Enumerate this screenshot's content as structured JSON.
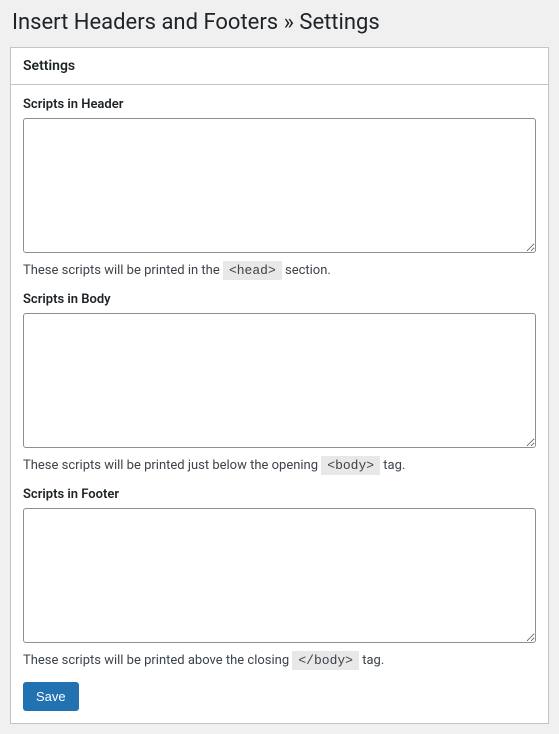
{
  "page_title": "Insert Headers and Footers » Settings",
  "panel": {
    "header_title": "Settings"
  },
  "fields": {
    "header": {
      "label": "Scripts in Header",
      "value": "",
      "help_text_prefix": "These scripts will be printed in the ",
      "help_code": "<head>",
      "help_text_suffix": " section."
    },
    "body": {
      "label": "Scripts in Body",
      "value": "",
      "help_text_prefix": "These scripts will be printed just below the opening ",
      "help_code": "<body>",
      "help_text_suffix": " tag."
    },
    "footer": {
      "label": "Scripts in Footer",
      "value": "",
      "help_text_prefix": "These scripts will be printed above the closing ",
      "help_code": "</body>",
      "help_text_suffix": " tag."
    }
  },
  "save_button_label": "Save"
}
